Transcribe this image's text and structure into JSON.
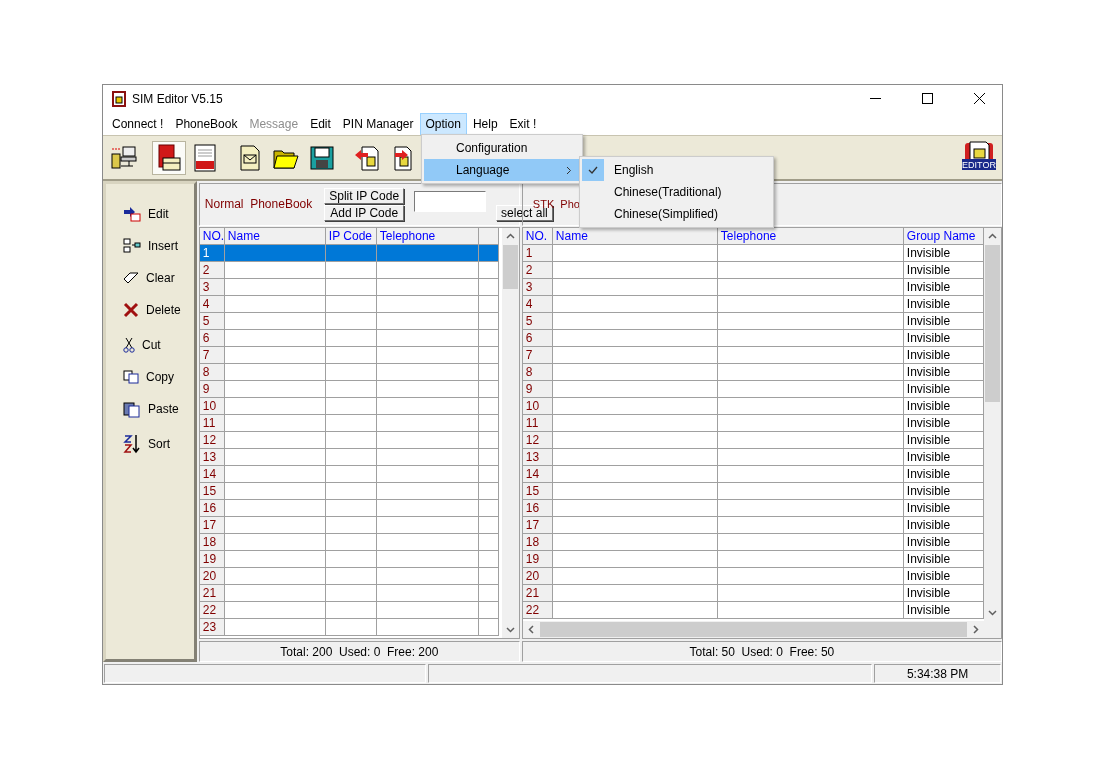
{
  "window": {
    "title": "SIM Editor V5.15"
  },
  "menu_bar": [
    {
      "label": "Connect !",
      "selected": false,
      "disabled": false
    },
    {
      "label": "PhoneBook",
      "selected": false,
      "disabled": false
    },
    {
      "label": "Message",
      "selected": false,
      "disabled": true
    },
    {
      "label": "Edit",
      "selected": false,
      "disabled": false
    },
    {
      "label": "PIN Manager",
      "selected": false,
      "disabled": false
    },
    {
      "label": "Option",
      "selected": true,
      "disabled": false
    },
    {
      "label": "Help",
      "selected": false,
      "disabled": false
    },
    {
      "label": "Exit !",
      "selected": false,
      "disabled": false
    }
  ],
  "option_menu": [
    {
      "label": "Configuration",
      "selected": false,
      "submenu": false
    },
    {
      "label": "Language",
      "selected": true,
      "submenu": true
    }
  ],
  "language_menu": [
    {
      "label": "English",
      "checked": true
    },
    {
      "label": "Chinese(Traditional)",
      "checked": false
    },
    {
      "label": "Chinese(Simplified)",
      "checked": false
    }
  ],
  "toolbar": {
    "groups": [
      {
        "buttons": [
          {
            "kind": "connect",
            "pressed": false
          }
        ]
      },
      {
        "buttons": [
          {
            "kind": "phonebook",
            "pressed": true
          },
          {
            "kind": "sms",
            "pressed": false
          }
        ]
      },
      {
        "buttons": [
          {
            "kind": "message",
            "pressed": false
          },
          {
            "kind": "open",
            "pressed": false
          },
          {
            "kind": "save",
            "pressed": false
          }
        ]
      },
      {
        "buttons": [
          {
            "kind": "sim-left",
            "pressed": false
          },
          {
            "kind": "sim-right",
            "pressed": false
          }
        ]
      }
    ],
    "logo_text": "EDITOR"
  },
  "sidebar": {
    "groups": [
      {
        "items": [
          {
            "label": "Edit",
            "kind": "edit"
          },
          {
            "label": "Insert",
            "kind": "insert"
          },
          {
            "label": "Clear",
            "kind": "clear"
          },
          {
            "label": "Delete",
            "kind": "delete"
          }
        ]
      },
      {
        "items": [
          {
            "label": "Cut",
            "kind": "cut"
          },
          {
            "label": "Copy",
            "kind": "copy"
          },
          {
            "label": "Paste",
            "kind": "paste"
          }
        ]
      },
      {
        "items": [
          {
            "label": "Sort",
            "kind": "sort"
          }
        ]
      }
    ]
  },
  "normal_phonebook": {
    "title": "Normal  PhoneBook",
    "buttons": [
      "Split IP Code",
      "Add IP Code"
    ],
    "select_all": "select all",
    "columns": [
      "NO.",
      "Name",
      "IP Code",
      "Telephone"
    ],
    "rows": [
      {
        "no": "1",
        "selected": true
      },
      {
        "no": "2",
        "selected": false
      },
      {
        "no": "3",
        "selected": false
      },
      {
        "no": "4",
        "selected": false
      },
      {
        "no": "5",
        "selected": false
      },
      {
        "no": "6",
        "selected": false
      },
      {
        "no": "7",
        "selected": false
      },
      {
        "no": "8",
        "selected": false
      },
      {
        "no": "9",
        "selected": false
      },
      {
        "no": "10",
        "selected": false
      },
      {
        "no": "11",
        "selected": false
      },
      {
        "no": "12",
        "selected": false
      },
      {
        "no": "13",
        "selected": false
      },
      {
        "no": "14",
        "selected": false
      },
      {
        "no": "15",
        "selected": false
      },
      {
        "no": "16",
        "selected": false
      },
      {
        "no": "17",
        "selected": false
      },
      {
        "no": "18",
        "selected": false
      },
      {
        "no": "19",
        "selected": false
      },
      {
        "no": "20",
        "selected": false
      },
      {
        "no": "21",
        "selected": false
      },
      {
        "no": "22",
        "selected": false
      },
      {
        "no": "23",
        "selected": false
      }
    ],
    "summary": "Total: 200  Used: 0  Free: 200"
  },
  "stk_phonebook": {
    "title": "STK  Pho",
    "columns": [
      "NO.",
      "Name",
      "Telephone",
      "Group Name"
    ],
    "rows": [
      {
        "no": "1",
        "group": "Invisible"
      },
      {
        "no": "2",
        "group": "Invisible"
      },
      {
        "no": "3",
        "group": "Invisible"
      },
      {
        "no": "4",
        "group": "Invisible"
      },
      {
        "no": "5",
        "group": "Invisible"
      },
      {
        "no": "6",
        "group": "Invisible"
      },
      {
        "no": "7",
        "group": "Invisible"
      },
      {
        "no": "8",
        "group": "Invisible"
      },
      {
        "no": "9",
        "group": "Invisible"
      },
      {
        "no": "10",
        "group": "Invisible"
      },
      {
        "no": "11",
        "group": "Invisible"
      },
      {
        "no": "12",
        "group": "Invisible"
      },
      {
        "no": "13",
        "group": "Invisible"
      },
      {
        "no": "14",
        "group": "Invisible"
      },
      {
        "no": "15",
        "group": "Invisible"
      },
      {
        "no": "16",
        "group": "Invisible"
      },
      {
        "no": "17",
        "group": "Invisible"
      },
      {
        "no": "18",
        "group": "Invisible"
      },
      {
        "no": "19",
        "group": "Invisible"
      },
      {
        "no": "20",
        "group": "Invisible"
      },
      {
        "no": "21",
        "group": "Invisible"
      },
      {
        "no": "22",
        "group": "Invisible"
      }
    ],
    "summary": "Total: 50  Used: 0  Free: 50"
  },
  "status_bar": {
    "time": "5:34:38 PM"
  }
}
